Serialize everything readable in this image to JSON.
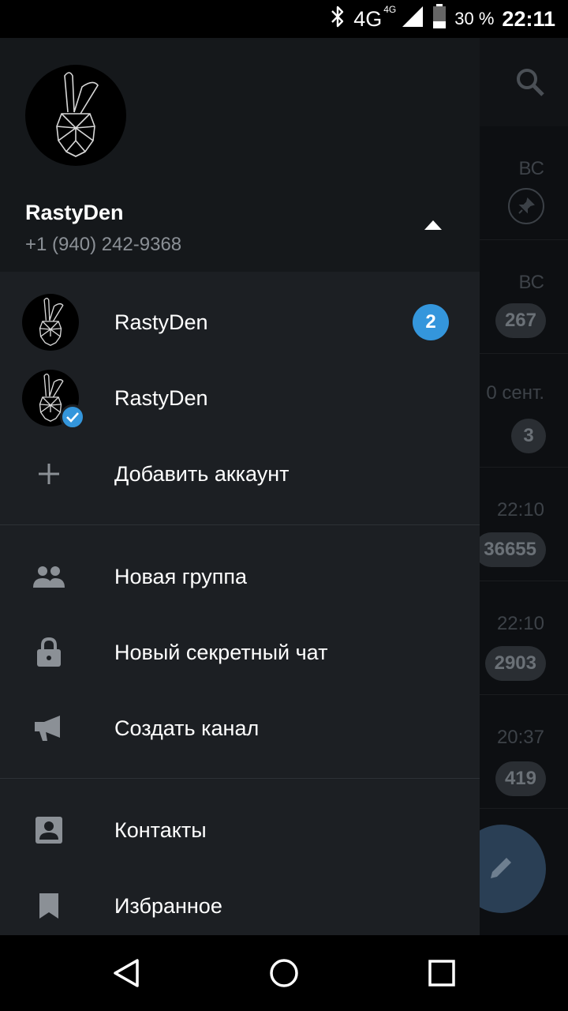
{
  "status_bar": {
    "network": "4G",
    "network_small": "4G",
    "battery": "30 %",
    "time": "22:11",
    "icons": [
      "bluetooth-icon",
      "signal-icon",
      "battery-icon"
    ]
  },
  "background_list": {
    "rows": [
      {
        "time": "ВС",
        "badge": ""
      },
      {
        "time": "ВС",
        "badge": "267"
      },
      {
        "time": "0 сент.",
        "badge": "3"
      },
      {
        "time": "22:10",
        "badge": "36655"
      },
      {
        "time": "22:10",
        "badge": "2903"
      },
      {
        "time": "20:37",
        "badge": "419"
      }
    ]
  },
  "drawer": {
    "user": {
      "name": "RastyDen",
      "phone": "+1 (940) 242-9368"
    },
    "accounts": [
      {
        "name": "RastyDen",
        "unread": "2"
      },
      {
        "name": "RastyDen",
        "unread": ""
      }
    ],
    "add_account": "Добавить аккаунт",
    "menu": [
      {
        "label": "Новая группа",
        "icon": "group-icon"
      },
      {
        "label": "Новый секретный чат",
        "icon": "lock-icon"
      },
      {
        "label": "Создать канал",
        "icon": "megaphone-icon"
      },
      {
        "label": "Контакты",
        "icon": "contact-icon"
      },
      {
        "label": "Избранное",
        "icon": "bookmark-icon"
      }
    ]
  },
  "colors": {
    "accent": "#3496dc",
    "drawer_bg": "#1c1f23",
    "header_bg": "#15181b"
  }
}
